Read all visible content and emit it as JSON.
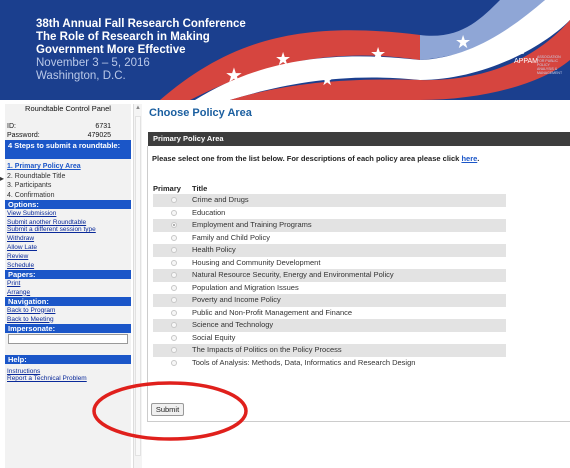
{
  "banner": {
    "line1": "38th Annual Fall Research Conference",
    "line2": "The Role of Research in Making",
    "line3": "Government More Effective",
    "line4": "November 3 – 5, 2016",
    "line5": "Washington, D.C.",
    "org": "APPAM",
    "org_sub": "ASSOCIATION FOR PUBLIC POLICY ANALYSIS & MANAGEMENT",
    "colors": {
      "blue": "#1b3f8e",
      "red": "#d6453f",
      "white": "#ffffff"
    }
  },
  "sidebar": {
    "title": "Roundtable Control Panel",
    "id_label": "ID:",
    "id_value": "6731",
    "password_label": "Password:",
    "password_value": "479025",
    "steps_heading": "4 Steps to submit a roundtable:",
    "steps": [
      "1. Primary Policy Area",
      "2. Roundtable Title",
      "3. Participants",
      "4. Confirmation"
    ],
    "options_heading": "Options:",
    "options": [
      "View Submission",
      "Submit another Roundtable",
      "Submit a different session type",
      "Withdraw",
      "Allow Late",
      "Review",
      "Schedule"
    ],
    "papers_heading": "Papers:",
    "papers": [
      "Print",
      "Arrange"
    ],
    "navigation_heading": "Navigation:",
    "navigation": [
      "Back to Program",
      "Back to Meeting"
    ],
    "impersonate_heading": "Impersonate:",
    "impersonate_value": "",
    "help_heading": "Help:",
    "help": [
      "Instructions",
      "Report a Technical Problem"
    ],
    "accent": "#1b56c8"
  },
  "main": {
    "title": "Choose Policy Area",
    "panel_heading": "Primary Policy Area",
    "intro_text": "Please select one from the list below. For descriptions of each policy area please click",
    "intro_link": "here",
    "col_primary": "Primary",
    "col_title": "Title",
    "selected_index": 2,
    "policy_areas": [
      "Crime and Drugs",
      "Education",
      "Employment and Training Programs",
      "Family and Child Policy",
      "Health Policy",
      "Housing and Community Development",
      "Natural Resource Security, Energy and Environmental Policy",
      "Population and Migration Issues",
      "Poverty and Income Policy",
      "Public and Non-Profit Management and Finance",
      "Science and Technology",
      "Social Equity",
      "The Impacts of Politics on the Policy Process",
      "Tools of Analysis: Methods, Data, Informatics and Research Design"
    ],
    "submit_label": "Submit",
    "annotation_color": "#e0201c"
  }
}
